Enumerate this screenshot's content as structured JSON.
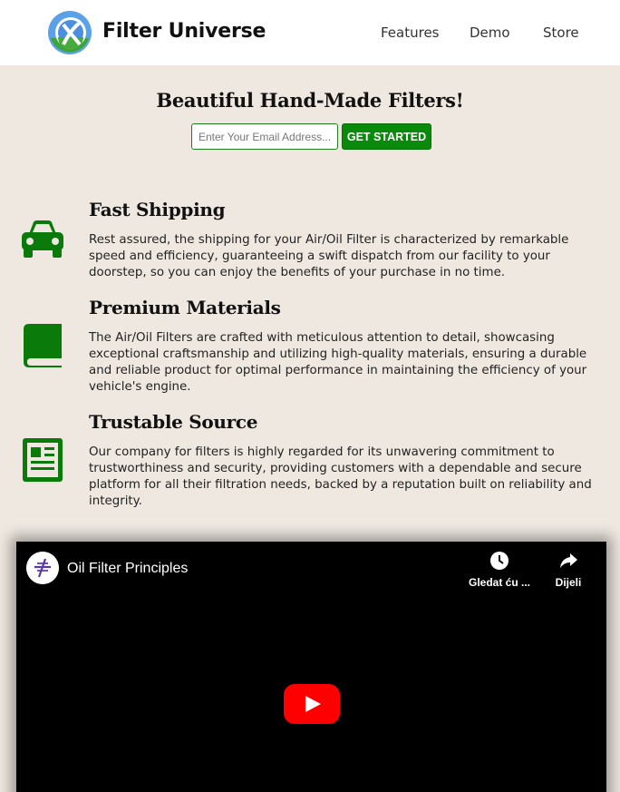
{
  "header": {
    "brand": "Filter Universe",
    "nav": [
      "Features",
      "Demo",
      "Store"
    ]
  },
  "hero": {
    "title": "Beautiful Hand-Made Filters!",
    "email_placeholder": "Enter Your Email Address...",
    "cta_label": "GET STARTED"
  },
  "features": [
    {
      "icon": "car-icon",
      "title": "Fast Shipping",
      "text": "Rest assured, the shipping for your Air/Oil Filter is characterized by remarkable speed and efficiency, guaranteeing a swift dispatch from our facility to your doorstep, so you can enjoy the benefits of your purchase in no time."
    },
    {
      "icon": "book-icon",
      "title": "Premium Materials",
      "text": "The Air/Oil Filters are crafted with meticulous attention to detail, showcasing exceptional craftsmanship and utilizing high-quality materials, ensuring a durable and reliable product for optimal performance in maintaining the efficiency of your vehicle's engine."
    },
    {
      "icon": "newspaper-icon",
      "title": "Trustable Source",
      "text": "Our company for filters is highly regarded for its unwavering commitment to trustworthiness and security, providing customers with a dependable and secure platform for all their filtration needs, backed by a reputation built on reliability and integrity."
    }
  ],
  "video": {
    "title": "Oil Filter Principles",
    "watch_later_label": "Gledat ću ...",
    "share_label": "Dijeli"
  },
  "colors": {
    "accent_green": "#0a8a0a",
    "page_background": "#efe8e1",
    "youtube_red": "#ff0000"
  }
}
